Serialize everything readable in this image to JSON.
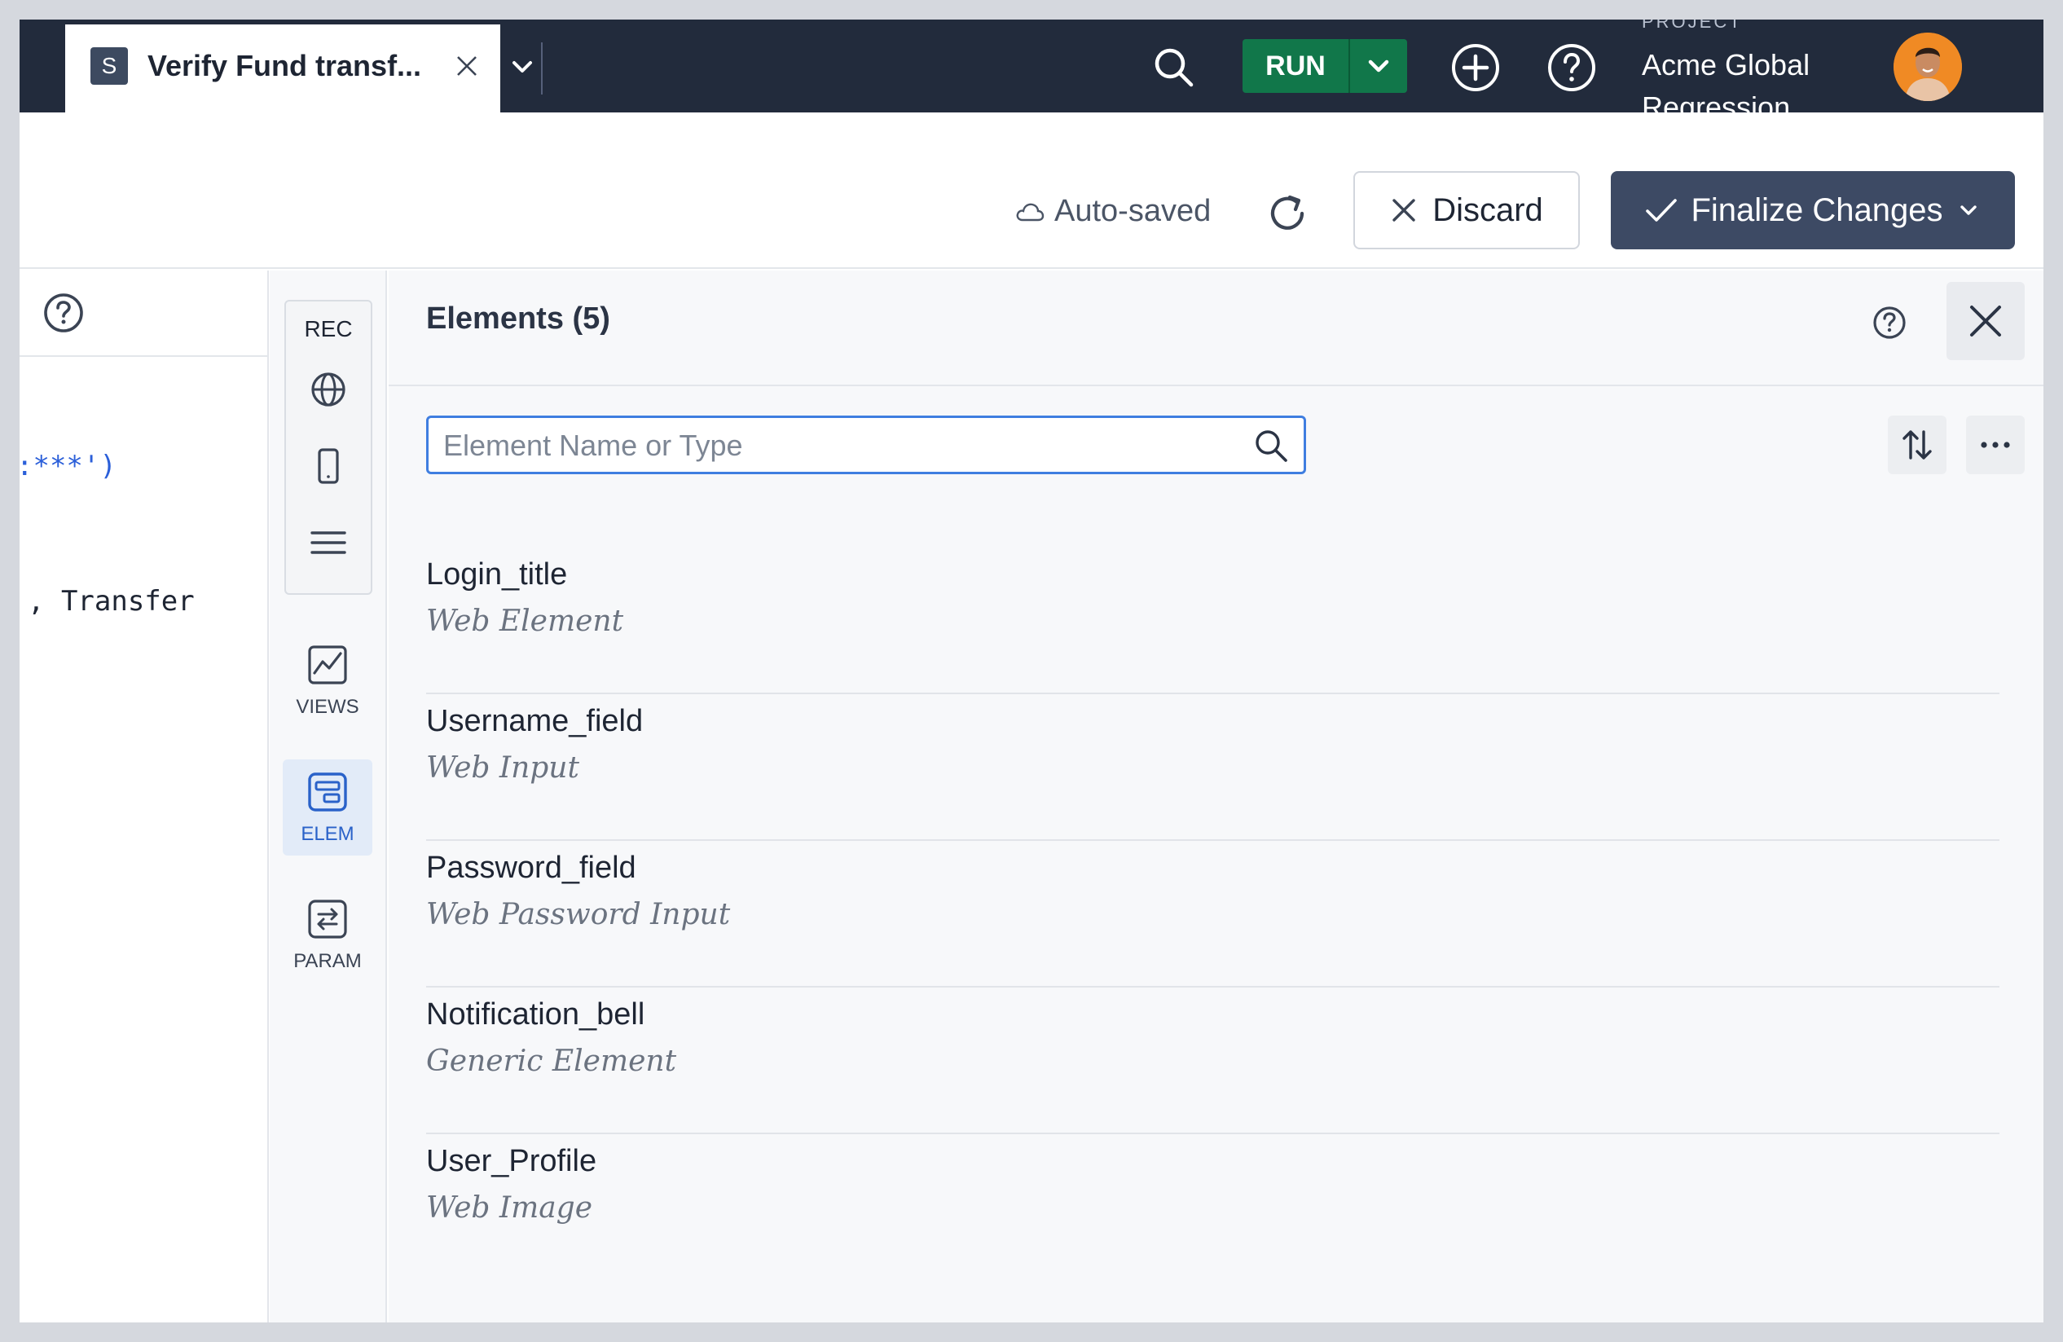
{
  "topbar": {
    "tab": {
      "badge": "S",
      "title": "Verify Fund transf..."
    },
    "run_label": "RUN",
    "project": {
      "label": "PROJECT",
      "name": "Acme Global Regression"
    }
  },
  "toolbar": {
    "autosaved": "Auto-saved",
    "discard": "Discard",
    "finalize": "Finalize Changes"
  },
  "code": {
    "line1_text": ":***')",
    "line2_text": ", Transfer"
  },
  "rail": {
    "rec": "REC",
    "items": [
      {
        "label": "VIEWS",
        "icon": "chart-icon"
      },
      {
        "label": "ELEM",
        "icon": "element-icon",
        "active": true
      },
      {
        "label": "PARAM",
        "icon": "swap-icon"
      }
    ]
  },
  "panel": {
    "title": "Elements (5)",
    "search": {
      "placeholder": "Element Name or Type",
      "value": ""
    },
    "elements": [
      {
        "name": "Login_title",
        "type": "Web Element"
      },
      {
        "name": "Username_field",
        "type": "Web Input"
      },
      {
        "name": "Password_field",
        "type": "Web Password Input"
      },
      {
        "name": "Notification_bell",
        "type": "Generic Element"
      },
      {
        "name": "User_Profile",
        "type": "Web Image"
      }
    ]
  },
  "colors": {
    "topbar": "#222b3c",
    "run": "#11774a",
    "finalize": "#3d4a64",
    "accent": "#3f7ee0"
  }
}
